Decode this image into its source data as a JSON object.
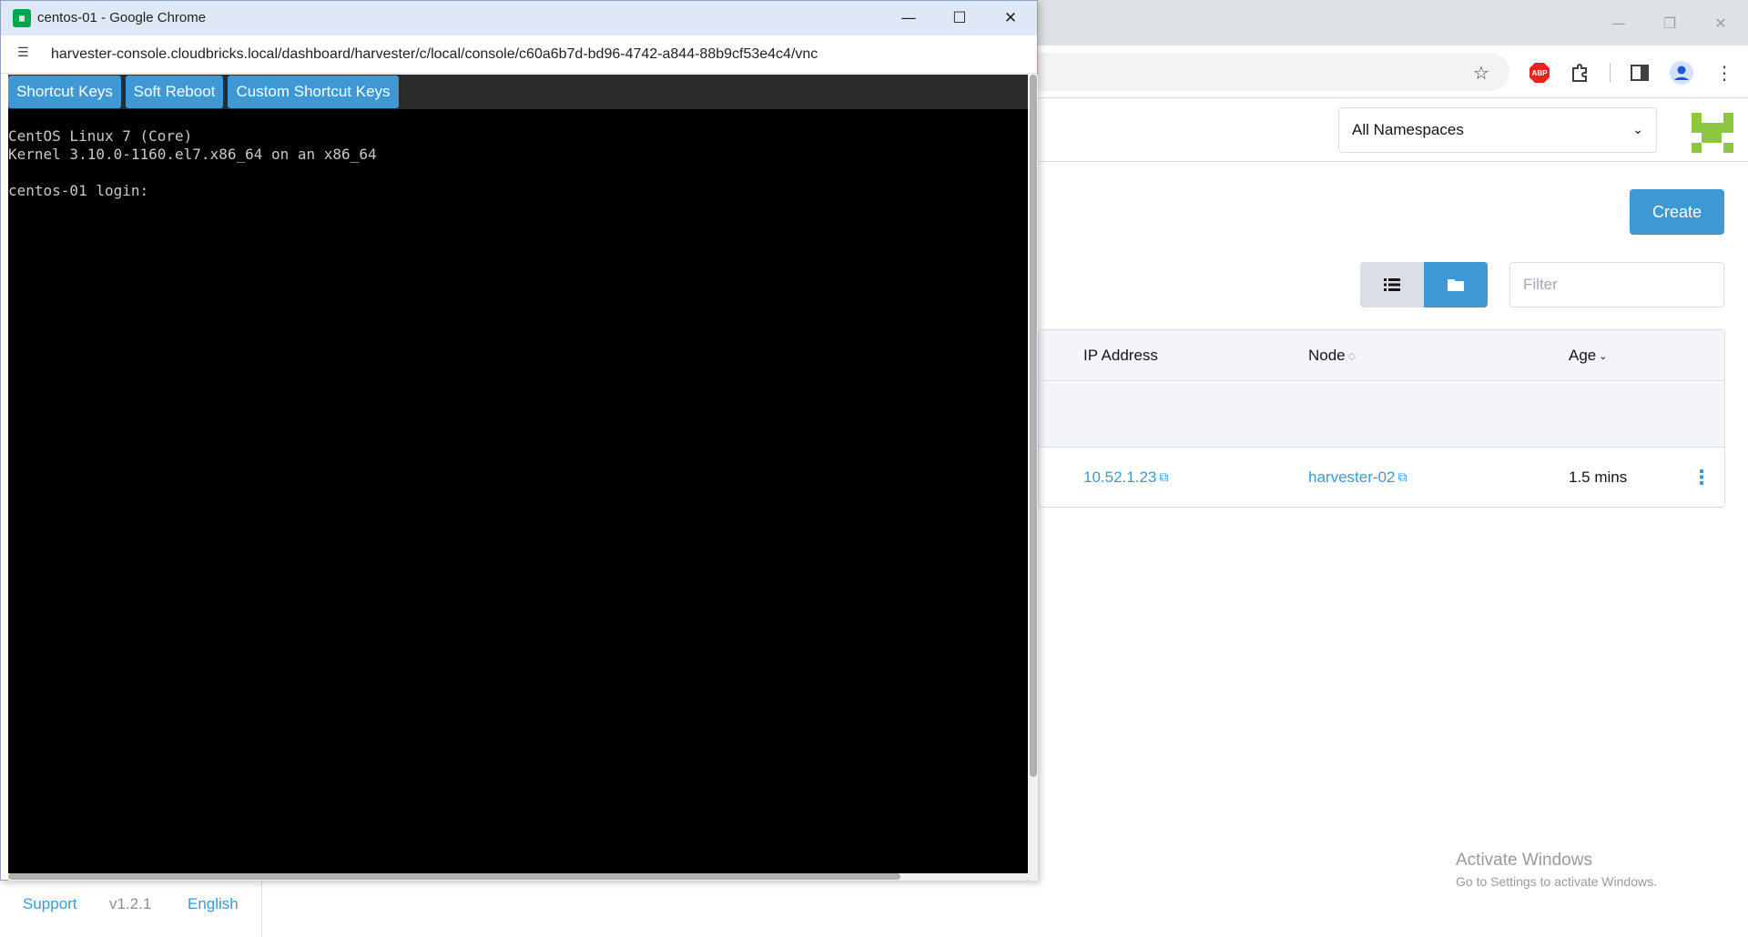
{
  "background_window": {
    "controls": {
      "minimize": "—",
      "restore": "❐",
      "close": "✕"
    },
    "toolbar_icons": [
      "star-icon",
      "adblock-icon",
      "extensions-icon",
      "sidepanel-icon",
      "profile-icon",
      "menu-icon"
    ],
    "adblock_label": "ABP",
    "namespace_select": {
      "value": "All Namespaces"
    },
    "create_label": "Create",
    "filter_placeholder": "Filter",
    "table": {
      "headers": {
        "ip": "IP Address",
        "node": "Node",
        "age": "Age"
      },
      "row": {
        "ip": "10.52.1.23",
        "node": "harvester-02",
        "age": "1.5 mins"
      }
    },
    "footer": {
      "support": "Support",
      "version": "v1.2.1",
      "language": "English"
    },
    "activate": {
      "title": "Activate Windows",
      "subtitle": "Go to Settings to activate Windows."
    },
    "colors": {
      "accent": "#3d98d3",
      "brand": "#8dc63f"
    }
  },
  "popup": {
    "title": "centos-01 - Google Chrome",
    "url": "harvester-console.cloudbricks.local/dashboard/harvester/c/local/console/c60a6b7d-bd96-4742-a844-88b9cf53e4c4/vnc",
    "toolbar": {
      "shortcut_keys": "Shortcut Keys",
      "soft_reboot": "Soft Reboot",
      "custom_shortcut_keys": "Custom Shortcut Keys"
    },
    "console_text": "CentOS Linux 7 (Core)\nKernel 3.10.0-1160.el7.x86_64 on an x86_64\n\ncentos-01 login: "
  }
}
